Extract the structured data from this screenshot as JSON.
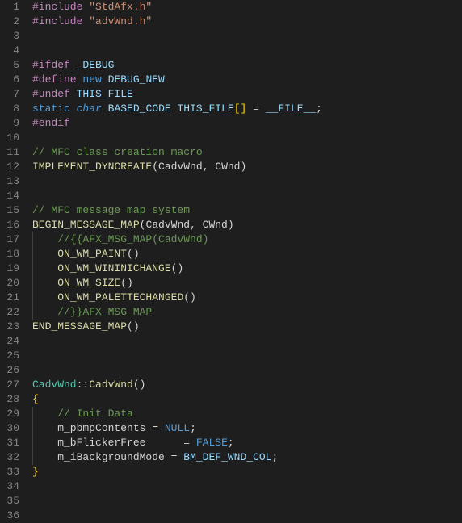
{
  "lineCount": 36,
  "lines": [
    {
      "n": 1,
      "indent": 0,
      "tokens": [
        {
          "c": "tok-pp",
          "t": "#include "
        },
        {
          "c": "tok-str",
          "t": "\"StdAfx.h\""
        }
      ]
    },
    {
      "n": 2,
      "indent": 0,
      "tokens": [
        {
          "c": "tok-pp",
          "t": "#include "
        },
        {
          "c": "tok-str",
          "t": "\"advWnd.h\""
        }
      ]
    },
    {
      "n": 3,
      "indent": 0,
      "tokens": []
    },
    {
      "n": 4,
      "indent": 0,
      "tokens": []
    },
    {
      "n": 5,
      "indent": 0,
      "tokens": [
        {
          "c": "tok-pp",
          "t": "#ifdef "
        },
        {
          "c": "tok-macro",
          "t": "_DEBUG"
        }
      ]
    },
    {
      "n": 6,
      "indent": 0,
      "tokens": [
        {
          "c": "tok-pp",
          "t": "#define "
        },
        {
          "c": "tok-kw2",
          "t": "new"
        },
        {
          "c": "tok-ident",
          "t": " "
        },
        {
          "c": "tok-macro",
          "t": "DEBUG_NEW"
        }
      ]
    },
    {
      "n": 7,
      "indent": 0,
      "tokens": [
        {
          "c": "tok-pp",
          "t": "#undef "
        },
        {
          "c": "tok-macro",
          "t": "THIS_FILE"
        }
      ]
    },
    {
      "n": 8,
      "indent": 0,
      "tokens": [
        {
          "c": "tok-kw2",
          "t": "static"
        },
        {
          "c": "tok-ident",
          "t": " "
        },
        {
          "c": "tok-type",
          "t": "char"
        },
        {
          "c": "tok-ident",
          "t": " "
        },
        {
          "c": "tok-macro",
          "t": "BASED_CODE"
        },
        {
          "c": "tok-ident",
          "t": " "
        },
        {
          "c": "tok-macro",
          "t": "THIS_FILE"
        },
        {
          "c": "tok-bracket",
          "t": "[]"
        },
        {
          "c": "tok-ident",
          "t": " "
        },
        {
          "c": "tok-op",
          "t": "="
        },
        {
          "c": "tok-ident",
          "t": " "
        },
        {
          "c": "tok-macro",
          "t": "__FILE__"
        },
        {
          "c": "tok-ident",
          "t": ";"
        }
      ]
    },
    {
      "n": 9,
      "indent": 0,
      "tokens": [
        {
          "c": "tok-pp",
          "t": "#endif"
        }
      ]
    },
    {
      "n": 10,
      "indent": 0,
      "tokens": []
    },
    {
      "n": 11,
      "indent": 0,
      "tokens": [
        {
          "c": "tok-comment",
          "t": "// MFC class creation macro"
        }
      ]
    },
    {
      "n": 12,
      "indent": 0,
      "tokens": [
        {
          "c": "tok-func",
          "t": "IMPLEMENT_DYNCREATE"
        },
        {
          "c": "tok-paren",
          "t": "("
        },
        {
          "c": "tok-ident",
          "t": "CadvWnd"
        },
        {
          "c": "tok-op",
          "t": ", "
        },
        {
          "c": "tok-ident",
          "t": "CWnd"
        },
        {
          "c": "tok-paren",
          "t": ")"
        }
      ]
    },
    {
      "n": 13,
      "indent": 0,
      "tokens": []
    },
    {
      "n": 14,
      "indent": 0,
      "tokens": []
    },
    {
      "n": 15,
      "indent": 0,
      "tokens": [
        {
          "c": "tok-comment",
          "t": "// MFC message map system"
        }
      ]
    },
    {
      "n": 16,
      "indent": 0,
      "tokens": [
        {
          "c": "tok-func",
          "t": "BEGIN_MESSAGE_MAP"
        },
        {
          "c": "tok-paren",
          "t": "("
        },
        {
          "c": "tok-ident",
          "t": "CadvWnd"
        },
        {
          "c": "tok-op",
          "t": ", "
        },
        {
          "c": "tok-ident",
          "t": "CWnd"
        },
        {
          "c": "tok-paren",
          "t": ")"
        }
      ]
    },
    {
      "n": 17,
      "indent": 1,
      "tokens": [
        {
          "c": "tok-ident",
          "t": "    "
        },
        {
          "c": "tok-comment",
          "t": "//{{AFX_MSG_MAP(CadvWnd)"
        }
      ]
    },
    {
      "n": 18,
      "indent": 1,
      "tokens": [
        {
          "c": "tok-ident",
          "t": "    "
        },
        {
          "c": "tok-func",
          "t": "ON_WM_PAINT"
        },
        {
          "c": "tok-paren",
          "t": "()"
        }
      ]
    },
    {
      "n": 19,
      "indent": 1,
      "tokens": [
        {
          "c": "tok-ident",
          "t": "    "
        },
        {
          "c": "tok-func",
          "t": "ON_WM_WININICHANGE"
        },
        {
          "c": "tok-paren",
          "t": "()"
        }
      ]
    },
    {
      "n": 20,
      "indent": 1,
      "tokens": [
        {
          "c": "tok-ident",
          "t": "    "
        },
        {
          "c": "tok-func",
          "t": "ON_WM_SIZE"
        },
        {
          "c": "tok-paren",
          "t": "()"
        }
      ]
    },
    {
      "n": 21,
      "indent": 1,
      "tokens": [
        {
          "c": "tok-ident",
          "t": "    "
        },
        {
          "c": "tok-func",
          "t": "ON_WM_PALETTECHANGED"
        },
        {
          "c": "tok-paren",
          "t": "()"
        }
      ]
    },
    {
      "n": 22,
      "indent": 1,
      "tokens": [
        {
          "c": "tok-ident",
          "t": "    "
        },
        {
          "c": "tok-comment",
          "t": "//}}AFX_MSG_MAP"
        }
      ]
    },
    {
      "n": 23,
      "indent": 0,
      "tokens": [
        {
          "c": "tok-func",
          "t": "END_MESSAGE_MAP"
        },
        {
          "c": "tok-paren",
          "t": "()"
        }
      ]
    },
    {
      "n": 24,
      "indent": 0,
      "tokens": []
    },
    {
      "n": 25,
      "indent": 0,
      "tokens": []
    },
    {
      "n": 26,
      "indent": 0,
      "tokens": []
    },
    {
      "n": 27,
      "indent": 0,
      "tokens": [
        {
          "c": "tok-classname",
          "t": "CadvWnd"
        },
        {
          "c": "tok-op",
          "t": "::"
        },
        {
          "c": "tok-func",
          "t": "CadvWnd"
        },
        {
          "c": "tok-paren",
          "t": "()"
        }
      ]
    },
    {
      "n": 28,
      "indent": 0,
      "tokens": [
        {
          "c": "tok-bracket",
          "t": "{"
        }
      ]
    },
    {
      "n": 29,
      "indent": 1,
      "tokens": [
        {
          "c": "tok-ident",
          "t": "    "
        },
        {
          "c": "tok-comment",
          "t": "// Init Data"
        }
      ]
    },
    {
      "n": 30,
      "indent": 1,
      "tokens": [
        {
          "c": "tok-ident",
          "t": "    m_pbmpContents "
        },
        {
          "c": "tok-op",
          "t": "="
        },
        {
          "c": "tok-ident",
          "t": " "
        },
        {
          "c": "tok-null",
          "t": "NULL"
        },
        {
          "c": "tok-ident",
          "t": ";"
        }
      ]
    },
    {
      "n": 31,
      "indent": 1,
      "tokens": [
        {
          "c": "tok-ident",
          "t": "    m_bFlickerFree      "
        },
        {
          "c": "tok-op",
          "t": "="
        },
        {
          "c": "tok-ident",
          "t": " "
        },
        {
          "c": "tok-false",
          "t": "FALSE"
        },
        {
          "c": "tok-ident",
          "t": ";"
        }
      ]
    },
    {
      "n": 32,
      "indent": 1,
      "tokens": [
        {
          "c": "tok-ident",
          "t": "    m_iBackgroundMode "
        },
        {
          "c": "tok-op",
          "t": "="
        },
        {
          "c": "tok-ident",
          "t": " "
        },
        {
          "c": "tok-macro",
          "t": "BM_DEF_WND_COL"
        },
        {
          "c": "tok-ident",
          "t": ";"
        }
      ]
    },
    {
      "n": 33,
      "indent": 0,
      "tokens": [
        {
          "c": "tok-bracket",
          "t": "}"
        }
      ]
    },
    {
      "n": 34,
      "indent": 0,
      "tokens": []
    },
    {
      "n": 35,
      "indent": 0,
      "tokens": []
    },
    {
      "n": 36,
      "indent": 0,
      "tokens": []
    }
  ]
}
